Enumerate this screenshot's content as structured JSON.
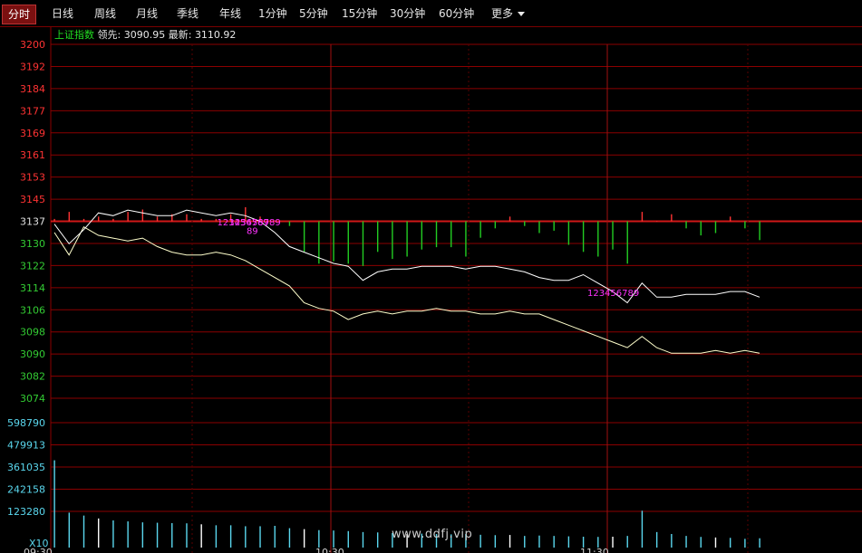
{
  "toolbar": {
    "tabs": [
      {
        "label": "分时",
        "active": true
      },
      {
        "label": "日线"
      },
      {
        "label": "周线"
      },
      {
        "label": "月线"
      },
      {
        "label": "季线"
      },
      {
        "label": "年线"
      },
      {
        "label": "1分钟"
      },
      {
        "label": "5分钟"
      },
      {
        "label": "15分钟"
      },
      {
        "label": "30分钟"
      },
      {
        "label": "60分钟"
      }
    ],
    "more_label": "更多"
  },
  "legend": {
    "index_name": "上证指数",
    "lead_label": "领先:",
    "lead_value": "3090.95",
    "latest_label": "最新:",
    "latest_value": "3110.92"
  },
  "price_axis": {
    "labels": [
      "3200",
      "3192",
      "3184",
      "3177",
      "3169",
      "3161",
      "3153",
      "3145",
      "3137",
      "3130",
      "3122",
      "3114",
      "3106",
      "3098",
      "3090",
      "3082",
      "3074"
    ],
    "ref_label": "3137",
    "colors": {
      "above": "#ff3333",
      "ref": "#e0e0e0",
      "below": "#33cc33"
    }
  },
  "volume_axis": {
    "labels": [
      "598790",
      "479913",
      "361035",
      "242158",
      "123280"
    ],
    "unit_label": "X10"
  },
  "time_axis": {
    "labels": [
      "09:30",
      "10:30",
      "11:30"
    ]
  },
  "watermark": "www.ddfj.vip",
  "colors": {
    "grid": "#8b0000",
    "latest_line": "#ffffff",
    "lead_line": "#ffffcc",
    "up": "#ff3333",
    "down": "#22cc22",
    "volume": "#5ad7ee",
    "signal": "#ff33ff"
  },
  "chart_data": {
    "type": "line",
    "title": "",
    "xlabel": "",
    "ylabel": "",
    "ylim": [
      3074,
      3200
    ],
    "reference": 3137,
    "x": [
      0,
      5,
      10,
      15,
      20,
      25,
      30,
      35,
      40,
      45,
      50,
      55,
      60,
      65,
      70,
      75,
      80,
      85,
      90,
      95,
      100,
      105,
      110,
      115,
      120,
      125,
      130,
      135,
      140,
      145,
      150,
      155,
      160,
      165,
      170,
      175,
      180,
      185,
      190,
      195,
      200,
      205,
      210,
      215,
      220,
      225,
      230,
      235,
      240
    ],
    "series": [
      {
        "name": "最新",
        "values": [
          3136,
          3129,
          3134,
          3140,
          3139,
          3141,
          3140,
          3139,
          3139,
          3141,
          3140,
          3139,
          3140,
          3139,
          3137,
          3133,
          3128,
          3126,
          3124,
          3122,
          3121,
          3116,
          3119,
          3120,
          3120,
          3121,
          3121,
          3121,
          3120,
          3121,
          3121,
          3120,
          3119,
          3117,
          3116,
          3116,
          3118,
          3115,
          3112,
          3108,
          3115,
          3110,
          3110,
          3111,
          3111,
          3111,
          3112,
          3112,
          3110
        ]
      },
      {
        "name": "领先",
        "values": [
          3133,
          3125,
          3135,
          3132,
          3131,
          3130,
          3131,
          3128,
          3126,
          3125,
          3125,
          3126,
          3125,
          3123,
          3120,
          3117,
          3114,
          3108,
          3106,
          3105,
          3102,
          3104,
          3105,
          3104,
          3105,
          3105,
          3106,
          3105,
          3105,
          3104,
          3104,
          3105,
          3104,
          3104,
          3102,
          3100,
          3098,
          3096,
          3094,
          3092,
          3096,
          3092,
          3090,
          3090,
          3090,
          3091,
          3090,
          3091,
          3090
        ]
      }
    ],
    "bars_up_down": [
      1,
      4,
      1,
      2,
      1,
      4,
      5,
      2,
      3,
      3,
      1,
      1,
      3,
      6,
      2,
      0,
      -2,
      -13,
      -18,
      -17,
      -18,
      -19,
      -13,
      -16,
      -15,
      -12,
      -11,
      -11,
      -15,
      -7,
      -3,
      2,
      -2,
      -5,
      -4,
      -10,
      -13,
      -15,
      -12,
      -18,
      4,
      0,
      3,
      -3,
      -6,
      -5,
      2,
      -3,
      -8
    ],
    "volume": [
      450,
      180,
      165,
      150,
      140,
      135,
      130,
      128,
      126,
      125,
      120,
      115,
      115,
      110,
      110,
      112,
      100,
      95,
      90,
      88,
      85,
      80,
      78,
      75,
      70,
      72,
      70,
      68,
      70,
      66,
      64,
      65,
      60,
      62,
      60,
      58,
      56,
      55,
      56,
      60,
      190,
      80,
      70,
      60,
      55,
      52,
      50,
      45,
      48
    ],
    "signals": [
      {
        "x": 56,
        "text": "123456789"
      },
      {
        "x": 60,
        "text": "123456789"
      },
      {
        "x": 66,
        "text": "89"
      },
      {
        "x": 182,
        "text": "123456789"
      }
    ]
  }
}
